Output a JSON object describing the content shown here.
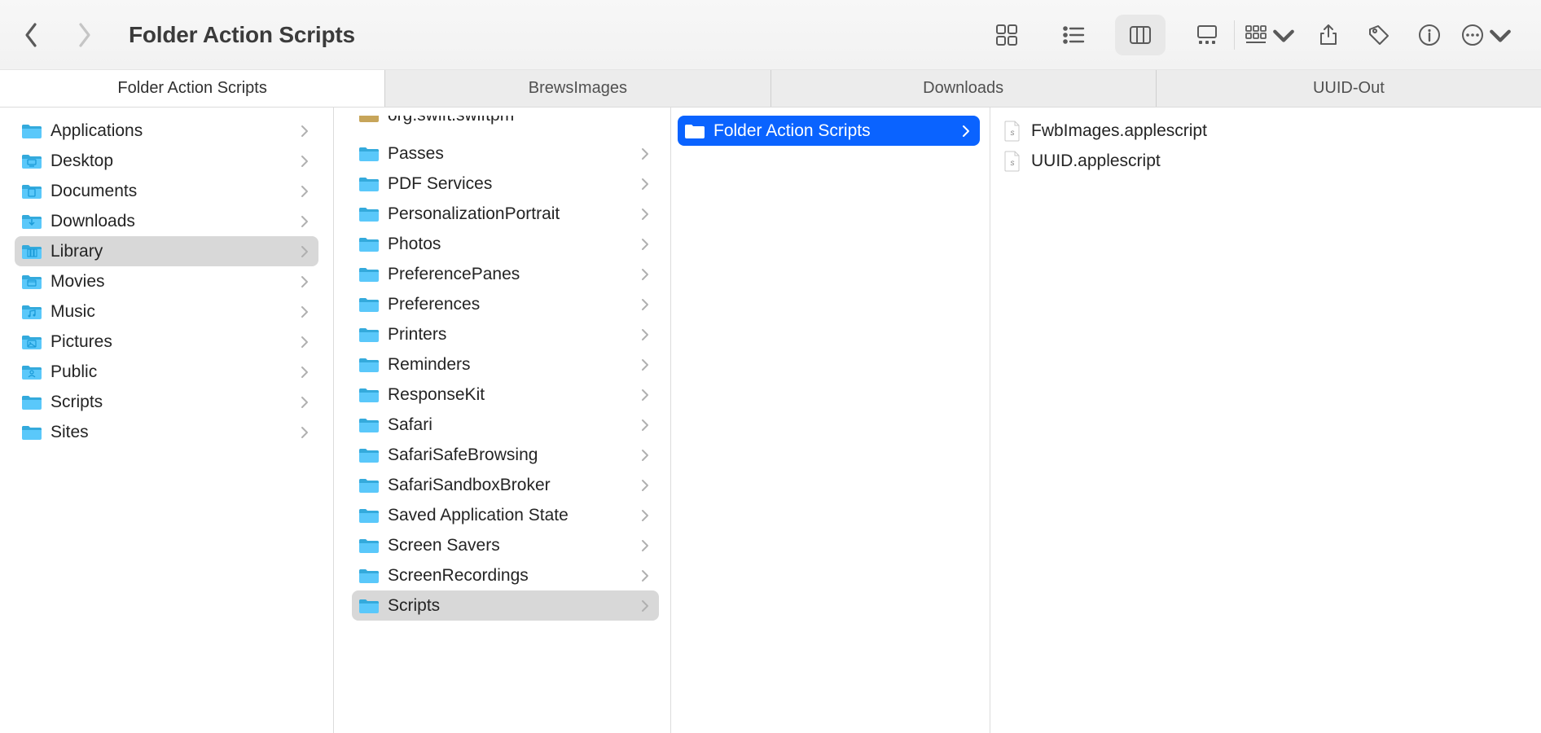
{
  "window": {
    "title": "Folder Action Scripts"
  },
  "tabs": [
    {
      "label": "Folder Action Scripts",
      "active": true
    },
    {
      "label": "BrewsImages",
      "active": false
    },
    {
      "label": "Downloads",
      "active": false
    },
    {
      "label": "UUID-Out",
      "active": false
    }
  ],
  "columns": {
    "col1": [
      {
        "name": "Applications",
        "icon": "folder",
        "hasChildren": true
      },
      {
        "name": "Desktop",
        "icon": "folder-desktop",
        "hasChildren": true
      },
      {
        "name": "Documents",
        "icon": "folder-documents",
        "hasChildren": true
      },
      {
        "name": "Downloads",
        "icon": "folder-downloads",
        "hasChildren": true
      },
      {
        "name": "Library",
        "icon": "folder-library",
        "hasChildren": true,
        "selected": "gray"
      },
      {
        "name": "Movies",
        "icon": "folder-movies",
        "hasChildren": true
      },
      {
        "name": "Music",
        "icon": "folder-music",
        "hasChildren": true
      },
      {
        "name": "Pictures",
        "icon": "folder-pictures",
        "hasChildren": true
      },
      {
        "name": "Public",
        "icon": "folder-public",
        "hasChildren": true
      },
      {
        "name": "Scripts",
        "icon": "folder",
        "hasChildren": true
      },
      {
        "name": "Sites",
        "icon": "folder",
        "hasChildren": true
      }
    ],
    "col2_cutoff": {
      "name": "org.swift.swiftpm",
      "icon": "folder-brown"
    },
    "col2": [
      {
        "name": "Passes",
        "icon": "folder",
        "hasChildren": true
      },
      {
        "name": "PDF Services",
        "icon": "folder",
        "hasChildren": true
      },
      {
        "name": "PersonalizationPortrait",
        "icon": "folder",
        "hasChildren": true
      },
      {
        "name": "Photos",
        "icon": "folder",
        "hasChildren": true
      },
      {
        "name": "PreferencePanes",
        "icon": "folder",
        "hasChildren": true
      },
      {
        "name": "Preferences",
        "icon": "folder",
        "hasChildren": true
      },
      {
        "name": "Printers",
        "icon": "folder",
        "hasChildren": true
      },
      {
        "name": "Reminders",
        "icon": "folder",
        "hasChildren": true
      },
      {
        "name": "ResponseKit",
        "icon": "folder",
        "hasChildren": true
      },
      {
        "name": "Safari",
        "icon": "folder",
        "hasChildren": true
      },
      {
        "name": "SafariSafeBrowsing",
        "icon": "folder",
        "hasChildren": true
      },
      {
        "name": "SafariSandboxBroker",
        "icon": "folder",
        "hasChildren": true
      },
      {
        "name": "Saved Application State",
        "icon": "folder",
        "hasChildren": true
      },
      {
        "name": "Screen Savers",
        "icon": "folder",
        "hasChildren": true
      },
      {
        "name": "ScreenRecordings",
        "icon": "folder",
        "hasChildren": true
      },
      {
        "name": "Scripts",
        "icon": "folder",
        "hasChildren": true,
        "selected": "gray"
      }
    ],
    "col3": [
      {
        "name": "Folder Action Scripts",
        "icon": "folder",
        "hasChildren": true,
        "selected": "blue"
      }
    ],
    "col4": [
      {
        "name": "FwbImages.applescript",
        "icon": "script"
      },
      {
        "name": "UUID.applescript",
        "icon": "script"
      }
    ]
  }
}
